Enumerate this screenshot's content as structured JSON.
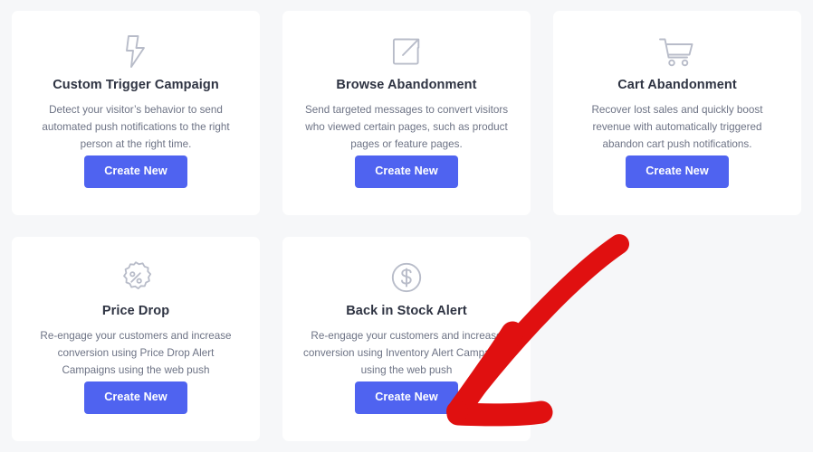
{
  "page": {
    "background_color": "#f6f7f9",
    "accent_color": "#4f63f0",
    "title_color": "#2e3342",
    "body_text_color": "#6d7385",
    "annotation_color": "#e01010"
  },
  "cards": [
    {
      "icon": "lightning-bolt-icon",
      "title": "Custom Trigger Campaign",
      "description": "Detect your visitor’s behavior to send automated push notifications to the right person at the right time.",
      "button_label": "Create New"
    },
    {
      "icon": "external-link-icon",
      "title": "Browse Abandonment",
      "description": "Send targeted messages to convert visitors who viewed certain pages, such as product pages or feature pages.",
      "button_label": "Create New"
    },
    {
      "icon": "shopping-cart-icon",
      "title": "Cart Abandonment",
      "description": "Recover lost sales and quickly boost revenue with automatically triggered abandon cart push notifications.",
      "button_label": "Create New"
    },
    {
      "icon": "percent-badge-icon",
      "title": "Price Drop",
      "description": "Re-engage your customers and increase conversion using Price Drop Alert Campaigns using the web push",
      "button_label": "Create New"
    },
    {
      "icon": "dollar-circle-icon",
      "title": "Back in Stock Alert",
      "description": "Re-engage your customers and increase conversion using Inventory Alert Campaigns using the web push",
      "button_label": "Create New"
    }
  ],
  "annotation": {
    "name": "red-arrow-pointing-to-back-in-stock-create-new-button",
    "color": "#e01010"
  }
}
